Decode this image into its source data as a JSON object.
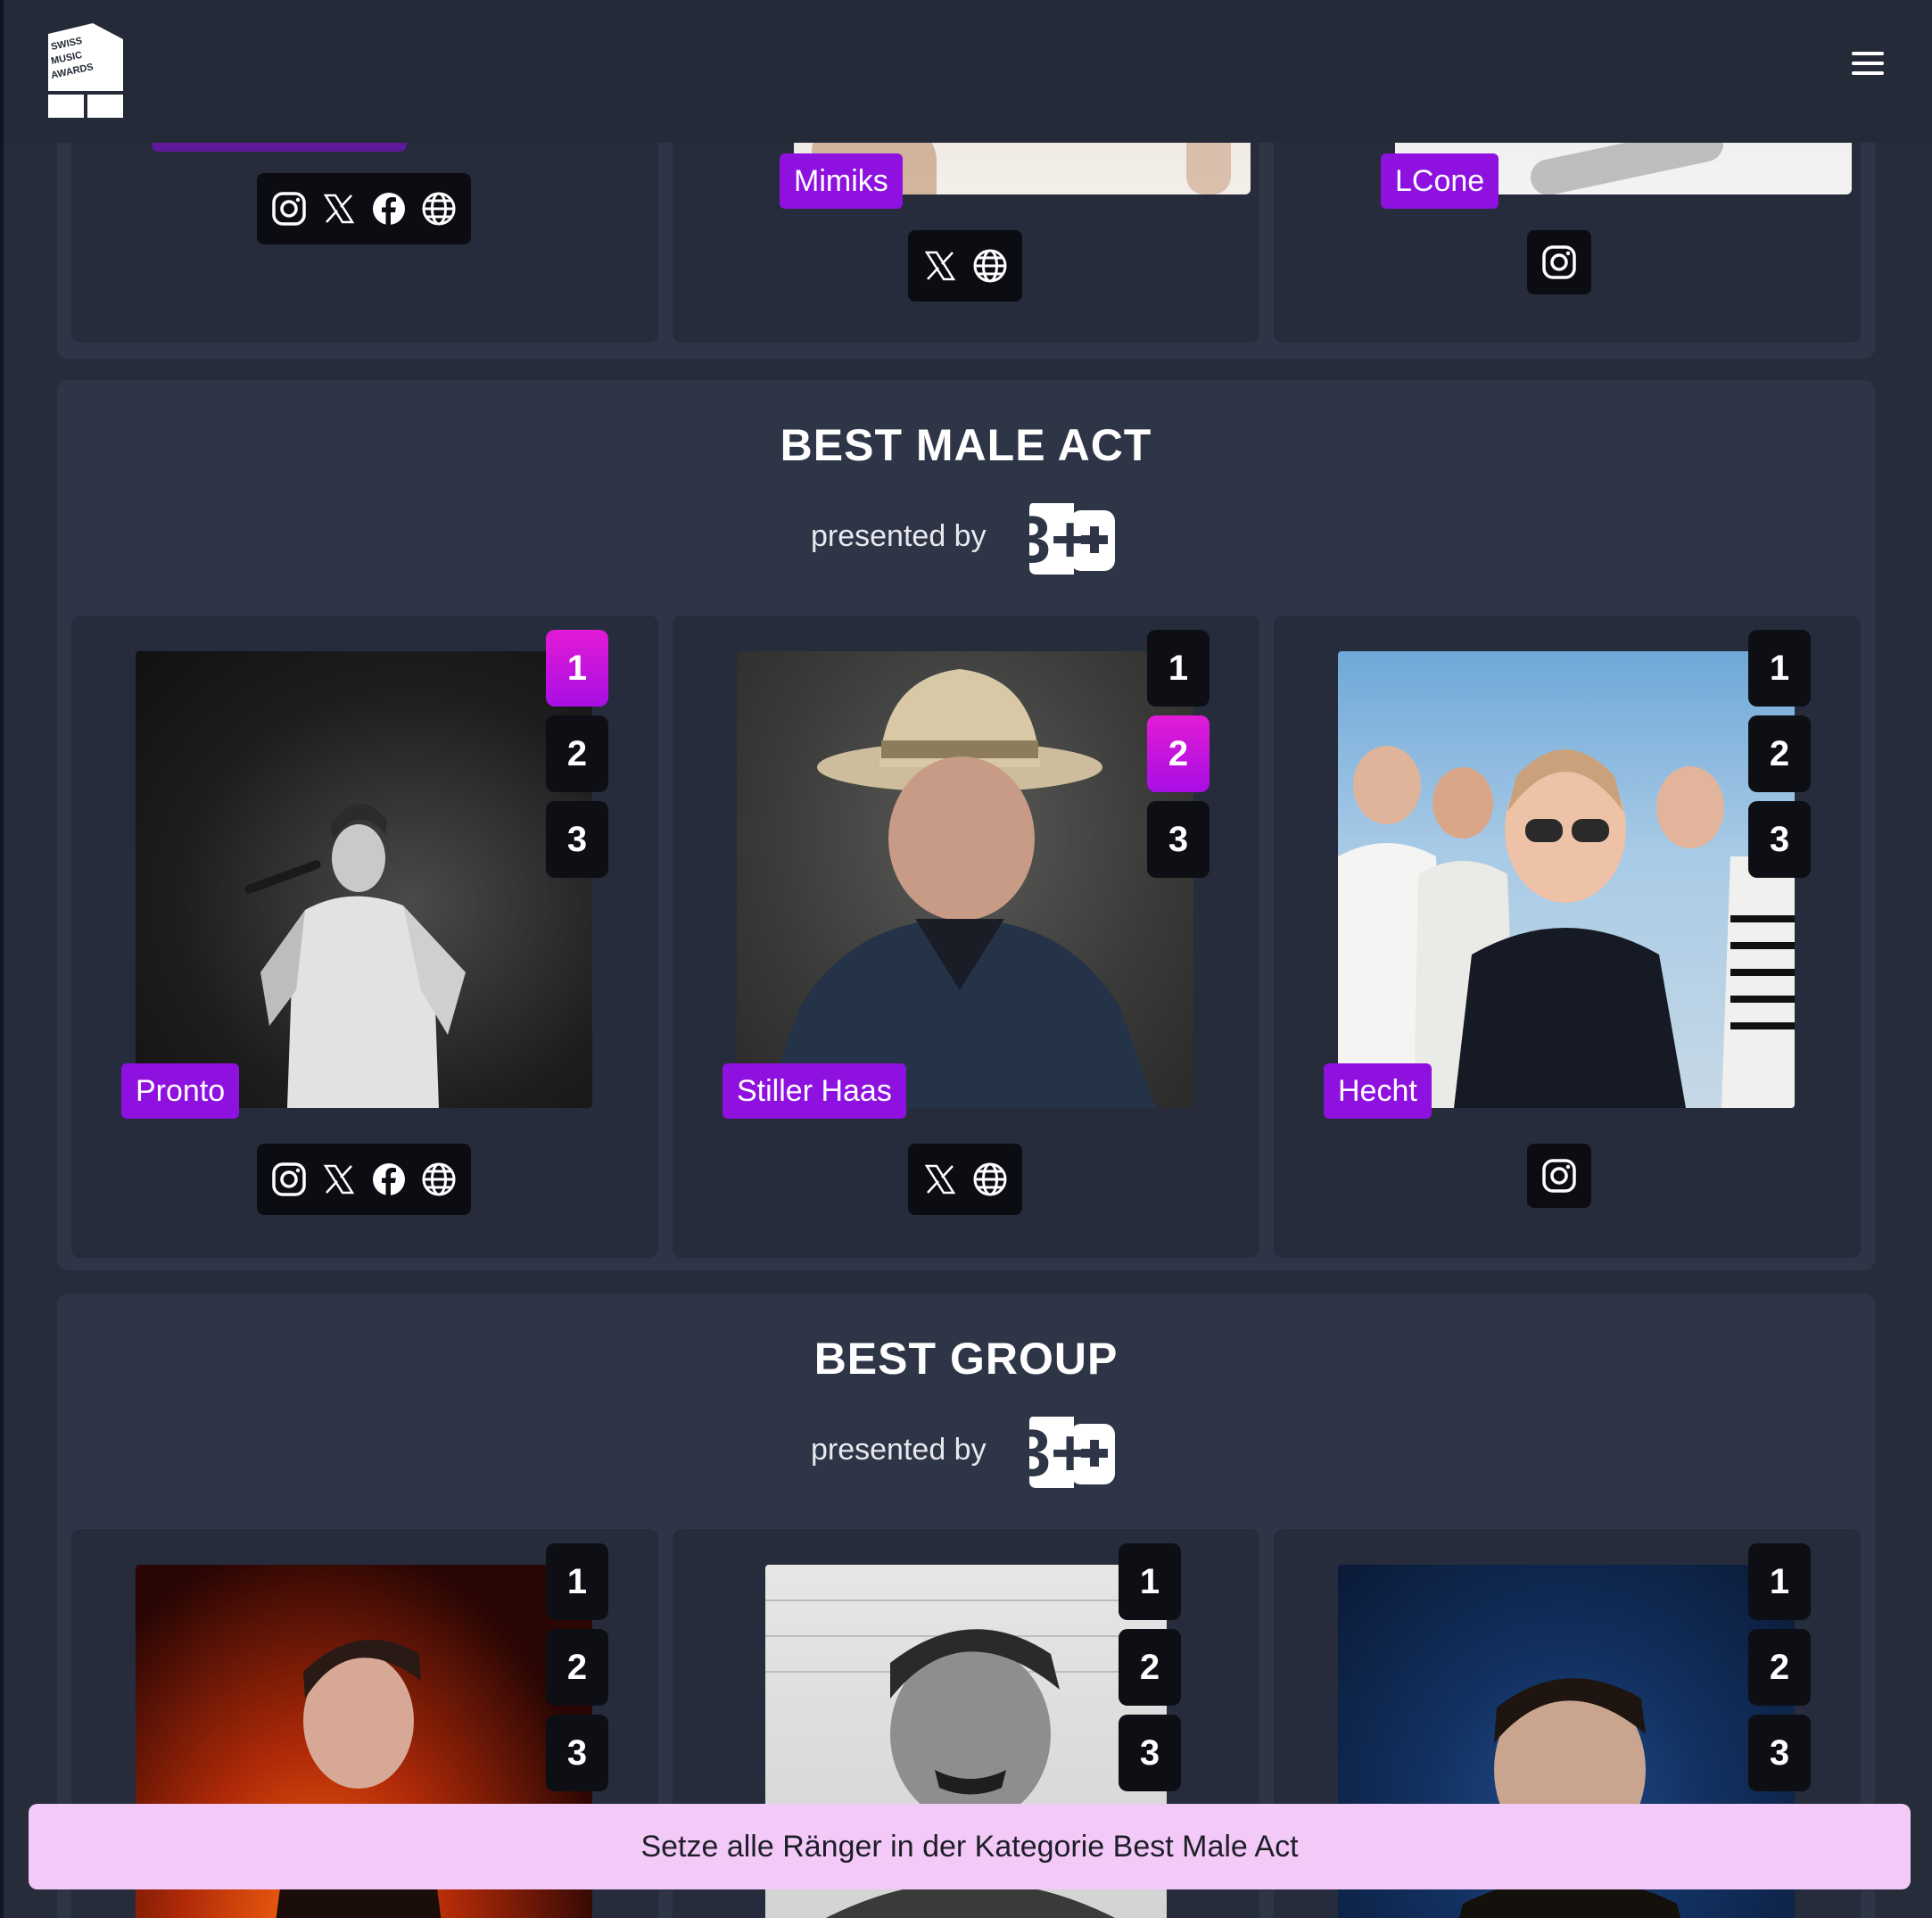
{
  "header": {
    "logo_alt": "Swiss Music Awards",
    "logo_lines": [
      "SWISS",
      "MUSIC",
      "AWARDS"
    ],
    "menu_icon": "hamburger-menu-icon"
  },
  "top_section": {
    "cards": [
      {
        "name": "",
        "socials": [
          "instagram-icon",
          "x-icon",
          "facebook-icon",
          "globe-icon"
        ]
      },
      {
        "name": "Mimiks",
        "socials": [
          "x-icon",
          "globe-icon"
        ]
      },
      {
        "name": "LCone",
        "socials": [
          "instagram-icon"
        ]
      }
    ]
  },
  "best_male_act": {
    "title": "BEST MALE ACT",
    "presented_by": "presented by",
    "sponsor": "3+",
    "cards": [
      {
        "name": "Pronto",
        "ranks": [
          "1",
          "2",
          "3"
        ],
        "selected_rank": "1",
        "socials": [
          "instagram-icon",
          "x-icon",
          "facebook-icon",
          "globe-icon"
        ]
      },
      {
        "name": "Stiller Haas",
        "ranks": [
          "1",
          "2",
          "3"
        ],
        "selected_rank": "2",
        "socials": [
          "x-icon",
          "globe-icon"
        ]
      },
      {
        "name": "Hecht",
        "ranks": [
          "1",
          "2",
          "3"
        ],
        "selected_rank": "",
        "socials": [
          "instagram-icon"
        ]
      }
    ]
  },
  "best_group": {
    "title": "BEST GROUP",
    "presented_by": "presented by",
    "sponsor": "3+",
    "cards": [
      {
        "ranks": [
          "1",
          "2",
          "3"
        ]
      },
      {
        "ranks": [
          "1",
          "2",
          "3"
        ]
      },
      {
        "ranks": [
          "1",
          "2",
          "3"
        ]
      }
    ]
  },
  "bottom_bar": {
    "label": "Setze alle Ränger in der Kategorie Best Male Act"
  },
  "colors": {
    "accent": "#8e11e0",
    "active_rank_top": "#e21bd6",
    "background": "#262c3a",
    "panel": "#2e3546",
    "bottom_bar": "#f2c9f7"
  }
}
